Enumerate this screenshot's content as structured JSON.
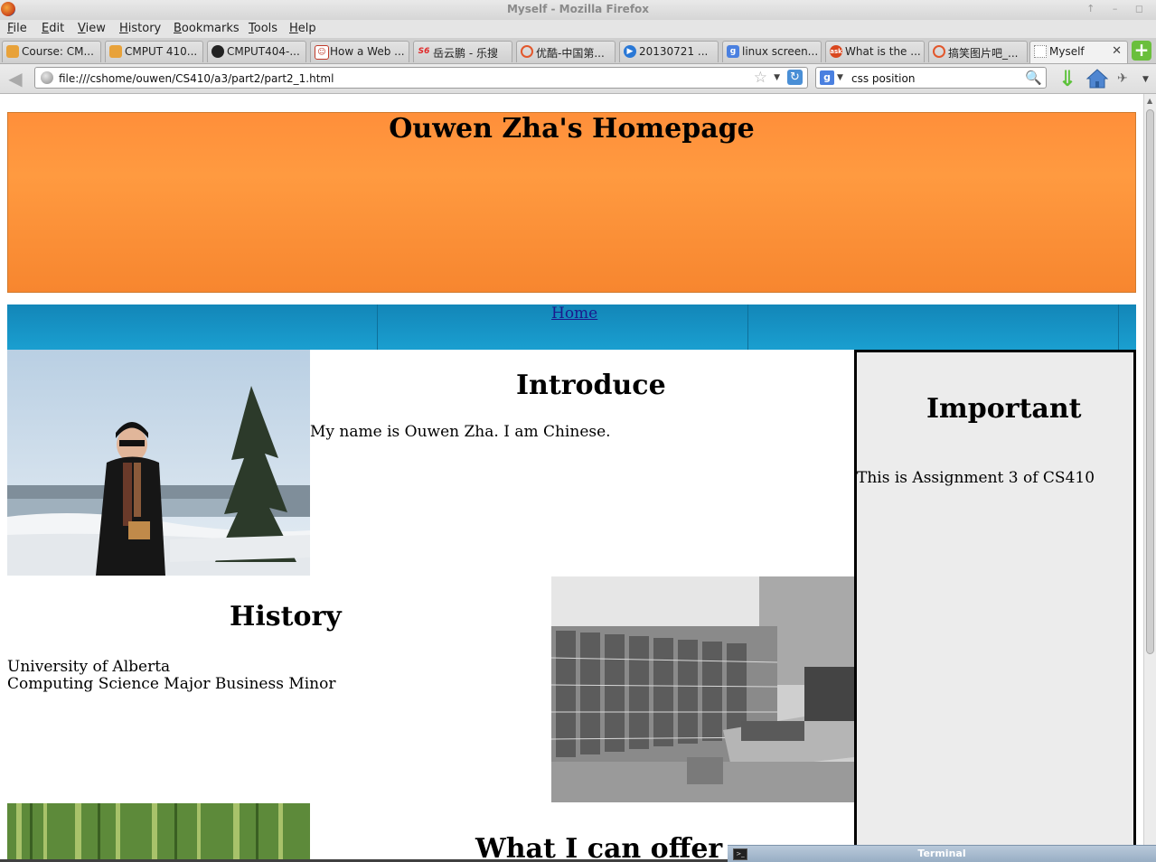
{
  "window": {
    "title": "Myself - Mozilla Firefox"
  },
  "menu": [
    "File",
    "Edit",
    "View",
    "History",
    "Bookmarks",
    "Tools",
    "Help"
  ],
  "tabs": [
    {
      "label": "Course: CM...",
      "icon": "moodle-icon",
      "color": "#e8a23a"
    },
    {
      "label": "CMPUT 410...",
      "icon": "moodle-icon",
      "color": "#e8a23a"
    },
    {
      "label": "CMPUT404-...",
      "icon": "github-icon",
      "color": "#222222"
    },
    {
      "label": "How a Web ...",
      "icon": "smiley-icon",
      "color": "#c03a2a"
    },
    {
      "label": "岳云鹏 - 乐搜",
      "icon": "s6-icon",
      "color": "#e02a2a"
    },
    {
      "label": "优酷-中国第...",
      "icon": "youku-icon",
      "color": "#e2572c"
    },
    {
      "label": "20130721 ...",
      "icon": "play-icon",
      "color": "#2a78d6"
    },
    {
      "label": "linux screen...",
      "icon": "google-icon",
      "color": "#4a80e0"
    },
    {
      "label": "What is the ...",
      "icon": "ask-icon",
      "color": "#d9471f"
    },
    {
      "label": "搞笑图片吧_...",
      "icon": "youku-icon",
      "color": "#e2572c"
    },
    {
      "label": "Myself",
      "icon": "blank-page-icon",
      "color": "#ffffff"
    }
  ],
  "nav": {
    "url": "file:///cshome/ouwen/CS410/a3/part2/part2_1.html",
    "search_value": "css position"
  },
  "page": {
    "header_title": "Ouwen Zha's Homepage",
    "nav_link": "Home",
    "introduce_heading": "Introduce",
    "introduce_text": "My name is Ouwen Zha. I am Chinese.",
    "history_heading": "History",
    "history_line1": "University of Alberta",
    "history_line2": "Computing Science Major Business Minor",
    "offer_heading": "What I can offer",
    "important_heading": "Important",
    "important_text": "This is Assignment 3 of CS410"
  },
  "taskbar": {
    "label": "Terminal"
  },
  "colors": {
    "header_orange": "#ff9a40",
    "nav_blue": "#1a9fd0",
    "aside_gray": "#ececec",
    "link": "#1b1a8c"
  }
}
